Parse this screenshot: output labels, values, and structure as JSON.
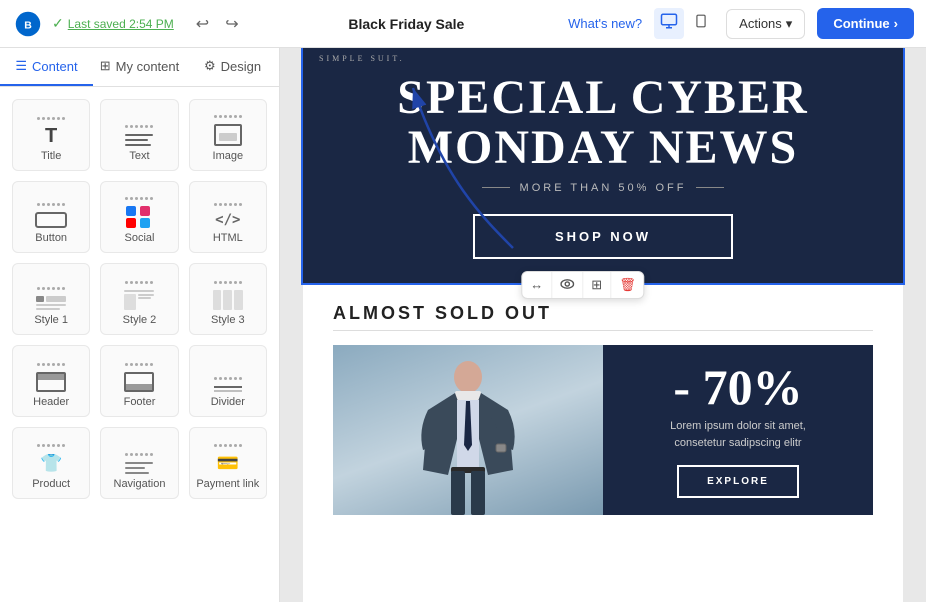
{
  "topbar": {
    "logo_alt": "Brevo logo",
    "saved_text": "Last saved 2:54 PM",
    "title": "Black Friday Sale",
    "whats_new": "What's new?",
    "actions_label": "Actions",
    "continue_label": "Continue"
  },
  "panel": {
    "tabs": [
      {
        "id": "content",
        "label": "Content",
        "icon": "☰",
        "active": true
      },
      {
        "id": "my_content",
        "label": "My content",
        "icon": "⊞"
      },
      {
        "id": "design",
        "label": "Design",
        "icon": "⚙"
      }
    ],
    "widgets": [
      {
        "id": "title",
        "label": "Title",
        "icon_type": "title"
      },
      {
        "id": "text",
        "label": "Text",
        "icon_type": "lines"
      },
      {
        "id": "image",
        "label": "Image",
        "icon_type": "image"
      },
      {
        "id": "button",
        "label": "Button",
        "icon_type": "button"
      },
      {
        "id": "social",
        "label": "Social",
        "icon_type": "social"
      },
      {
        "id": "html",
        "label": "HTML",
        "icon_type": "html"
      },
      {
        "id": "style1",
        "label": "Style 1",
        "icon_type": "style1"
      },
      {
        "id": "style2",
        "label": "Style 2",
        "icon_type": "style2"
      },
      {
        "id": "style3",
        "label": "Style 3",
        "icon_type": "style3"
      },
      {
        "id": "header",
        "label": "Header",
        "icon_type": "header"
      },
      {
        "id": "footer",
        "label": "Footer",
        "icon_type": "footer"
      },
      {
        "id": "divider",
        "label": "Divider",
        "icon_type": "divider"
      },
      {
        "id": "product",
        "label": "Product",
        "icon_type": "product"
      },
      {
        "id": "navigation",
        "label": "Navigation",
        "icon_type": "navigation"
      },
      {
        "id": "payment",
        "label": "Payment link",
        "icon_type": "payment"
      }
    ]
  },
  "email": {
    "top_label": "SIMPLE SUIT.",
    "hero_title_line1": "SPECIAL CYBER",
    "hero_title_line2": "MONDAY NEWS",
    "hero_sub": "MORE THAN 50% OFF",
    "shop_btn": "SHOP NOW",
    "section_title": "ALMOST SOLD OUT",
    "discount": "- 70%",
    "discount_desc_line1": "Lorem ipsum dolor sit amet,",
    "discount_desc_line2": "consetetur sadipscing elitr",
    "explore_btn": "EXPLORE"
  },
  "float_toolbar": {
    "icons": [
      "↔",
      "👁",
      "⊞",
      "🗑"
    ]
  },
  "colors": {
    "accent": "#2563eb",
    "hero_bg": "#1a2744",
    "white": "#ffffff"
  }
}
